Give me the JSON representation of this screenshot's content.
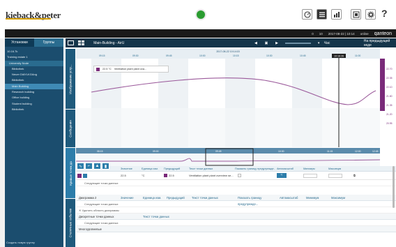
{
  "header": {
    "logo": "kieback&peter",
    "icons": [
      "gauge-icon",
      "list-icon",
      "building-chart-icon",
      "window-icon",
      "gear-icon",
      "help-icon"
    ],
    "help": "?"
  },
  "infobar": {
    "status1": "0",
    "status2": "10",
    "datetime": "2017-08-22 | 10:14",
    "user": "online",
    "brand": "qanteon"
  },
  "sidebar": {
    "tab_active": "Установки",
    "tab_inactive": "Группы",
    "items": [
      "10.16.7k",
      "Training estate 1",
      "University Node",
      "Bibliothek",
      "Neuer DiAYLKGAng",
      "Bibliothek",
      "Main Building",
      "Research building",
      "Office building",
      "Student building",
      "Bibliothek"
    ],
    "footer": "Создать новую группу"
  },
  "toolbar": {
    "title": "Main-Building - AirU",
    "range_label": "Час",
    "compare_label": "На предыдущей неде"
  },
  "vtabs": {
    "chart": "Изображение устр...",
    "messages": "Сообщения",
    "curves": "Кривые точек дa",
    "static": "Статичные события"
  },
  "chart": {
    "date_label": "2017-08-22 10:14:15",
    "cursor_label": "10:16:26",
    "top_ticks": [
      "09:15",
      "09:30",
      "09:45",
      "10:00",
      "10:15",
      "10:30",
      "10:45",
      "11:00"
    ],
    "right_ticks": [
      "22.70",
      "22.35",
      "22.10",
      "21.60",
      "21.35",
      "21.20",
      "20.95"
    ],
    "legend_value": "22.5 °C",
    "legend_text": "Ventilation plant plant ova...",
    "overview_ticks": [
      "08:15",
      "09:00",
      "09:45",
      "10:30",
      "11:15",
      "12:00",
      "12:45"
    ]
  },
  "table": {
    "headers": [
      "Значение",
      "Единица изм.",
      "Предыдущий",
      "Текст точки данных",
      "Показать границу предупрежде...",
      "Автомасштаб",
      "Минимум",
      "Максимум"
    ],
    "row": {
      "value": "22.5",
      "unit": "°C",
      "prev": "22.5",
      "text": "Ventilation plant plant overview se...",
      "min": "",
      "max": ""
    },
    "next_points": "Следующие точки данных",
    "diagram2": "Диаграмма 2",
    "delete_area": "Удалить область диаграммы",
    "discrete": "Дискретные точки данных",
    "discrete_col": "Текст точки данных",
    "next_points2": "Следующие точки данных",
    "next_points3": "Следующие точки данных",
    "multi_state": "Многоуровневые"
  },
  "colors": {
    "navy": "#15354a",
    "sidebar": "#1b4d6e",
    "accent": "#2c7daa",
    "line": "#9b5a9b",
    "selected": "#3f8ab5",
    "status_green": "#2a9c30"
  }
}
